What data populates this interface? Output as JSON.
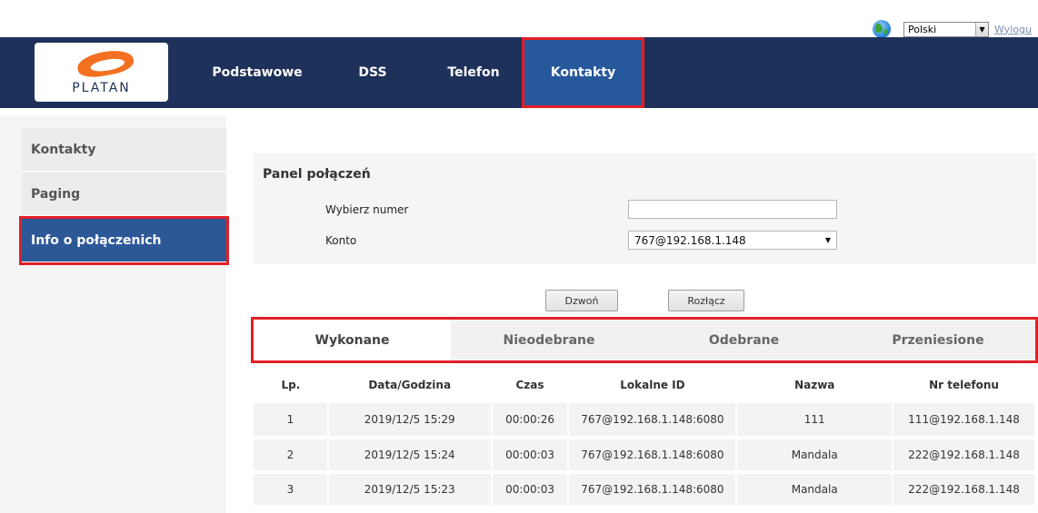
{
  "util": {
    "language": "Polski",
    "logout": "Wylogu"
  },
  "brand": {
    "logo_text": "PLATAN"
  },
  "nav": [
    {
      "label": "Podstawowe"
    },
    {
      "label": "DSS"
    },
    {
      "label": "Telefon"
    },
    {
      "label": "Kontakty"
    }
  ],
  "sidebar": [
    {
      "label": "Kontakty"
    },
    {
      "label": "Paging"
    },
    {
      "label": "Info o połączenich"
    }
  ],
  "panel": {
    "title": "Panel połączeń",
    "dial_label": "Wybierz numer",
    "dial_value": "",
    "account_label": "Konto",
    "account_value": "767@192.168.1.148"
  },
  "buttons": {
    "call": "Dzwoń",
    "hangup": "Rozłącz"
  },
  "tabs": [
    "Wykonane",
    "Nieodebrane",
    "Odebrane",
    "Przeniesione"
  ],
  "table": {
    "headers": [
      "Lp.",
      "Data/Godzina",
      "Czas",
      "Lokalne ID",
      "Nazwa",
      "Nr telefonu"
    ],
    "rows": [
      [
        "1",
        "2019/12/5 15:29",
        "00:00:26",
        "767@192.168.1.148:6080",
        "111",
        "111@192.168.1.148"
      ],
      [
        "2",
        "2019/12/5 15:24",
        "00:00:03",
        "767@192.168.1.148:6080",
        "Mandala",
        "222@192.168.1.148"
      ],
      [
        "3",
        "2019/12/5 15:23",
        "00:00:03",
        "767@192.168.1.148:6080",
        "Mandala",
        "222@192.168.1.148"
      ]
    ]
  }
}
